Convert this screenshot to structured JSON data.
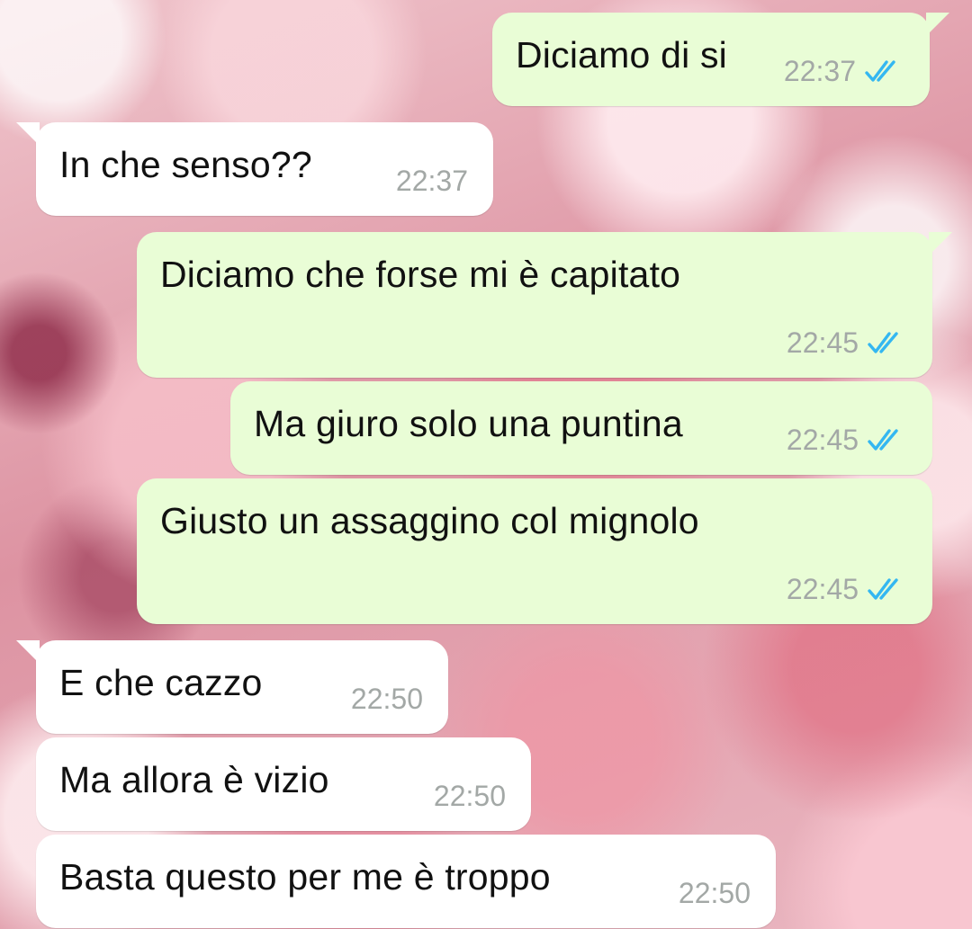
{
  "chat": {
    "messages": [
      {
        "direction": "outgoing",
        "text": "Diciamo di si",
        "time": "22:37",
        "status": "read"
      },
      {
        "direction": "incoming",
        "text": "In che senso??",
        "time": "22:37"
      },
      {
        "direction": "outgoing",
        "text": "Diciamo che forse mi è capitato",
        "time": "22:45",
        "status": "read"
      },
      {
        "direction": "outgoing",
        "text": "Ma giuro solo una puntina",
        "time": "22:45",
        "status": "read"
      },
      {
        "direction": "outgoing",
        "text": "Giusto un assaggino col mignolo",
        "time": "22:45",
        "status": "read"
      },
      {
        "direction": "incoming",
        "text": "E che cazzo",
        "time": "22:50"
      },
      {
        "direction": "incoming",
        "text": "Ma allora è vizio",
        "time": "22:50"
      },
      {
        "direction": "incoming",
        "text": "Basta questo per me è troppo",
        "time": "22:50"
      }
    ]
  },
  "colors": {
    "outgoing_bubble": "#e9fdd6",
    "incoming_bubble": "#ffffff",
    "read_ticks": "#34b7f1",
    "timestamp": "#a3a8a6"
  },
  "icons": {
    "read_receipt": "double-check-icon"
  }
}
